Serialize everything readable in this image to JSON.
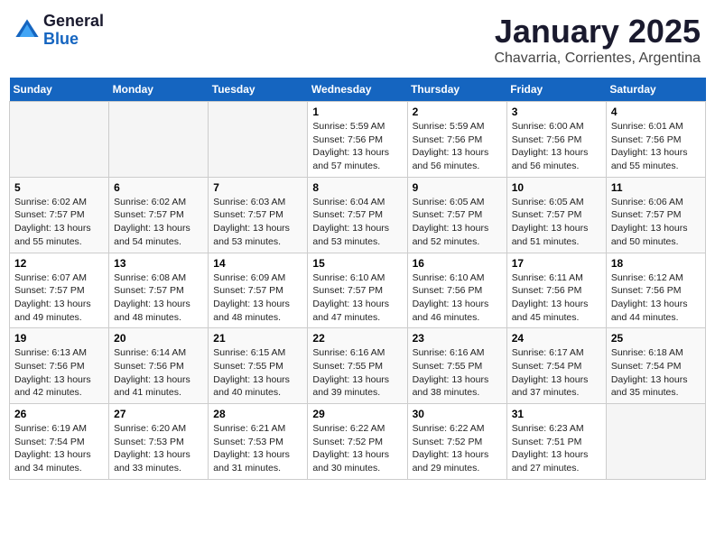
{
  "logo": {
    "general": "General",
    "blue": "Blue"
  },
  "title": "January 2025",
  "subtitle": "Chavarria, Corrientes, Argentina",
  "weekdays": [
    "Sunday",
    "Monday",
    "Tuesday",
    "Wednesday",
    "Thursday",
    "Friday",
    "Saturday"
  ],
  "weeks": [
    [
      {
        "day": "",
        "sunrise": "",
        "sunset": "",
        "daylight": ""
      },
      {
        "day": "",
        "sunrise": "",
        "sunset": "",
        "daylight": ""
      },
      {
        "day": "",
        "sunrise": "",
        "sunset": "",
        "daylight": ""
      },
      {
        "day": "1",
        "sunrise": "Sunrise: 5:59 AM",
        "sunset": "Sunset: 7:56 PM",
        "daylight": "Daylight: 13 hours and 57 minutes."
      },
      {
        "day": "2",
        "sunrise": "Sunrise: 5:59 AM",
        "sunset": "Sunset: 7:56 PM",
        "daylight": "Daylight: 13 hours and 56 minutes."
      },
      {
        "day": "3",
        "sunrise": "Sunrise: 6:00 AM",
        "sunset": "Sunset: 7:56 PM",
        "daylight": "Daylight: 13 hours and 56 minutes."
      },
      {
        "day": "4",
        "sunrise": "Sunrise: 6:01 AM",
        "sunset": "Sunset: 7:56 PM",
        "daylight": "Daylight: 13 hours and 55 minutes."
      }
    ],
    [
      {
        "day": "5",
        "sunrise": "Sunrise: 6:02 AM",
        "sunset": "Sunset: 7:57 PM",
        "daylight": "Daylight: 13 hours and 55 minutes."
      },
      {
        "day": "6",
        "sunrise": "Sunrise: 6:02 AM",
        "sunset": "Sunset: 7:57 PM",
        "daylight": "Daylight: 13 hours and 54 minutes."
      },
      {
        "day": "7",
        "sunrise": "Sunrise: 6:03 AM",
        "sunset": "Sunset: 7:57 PM",
        "daylight": "Daylight: 13 hours and 53 minutes."
      },
      {
        "day": "8",
        "sunrise": "Sunrise: 6:04 AM",
        "sunset": "Sunset: 7:57 PM",
        "daylight": "Daylight: 13 hours and 53 minutes."
      },
      {
        "day": "9",
        "sunrise": "Sunrise: 6:05 AM",
        "sunset": "Sunset: 7:57 PM",
        "daylight": "Daylight: 13 hours and 52 minutes."
      },
      {
        "day": "10",
        "sunrise": "Sunrise: 6:05 AM",
        "sunset": "Sunset: 7:57 PM",
        "daylight": "Daylight: 13 hours and 51 minutes."
      },
      {
        "day": "11",
        "sunrise": "Sunrise: 6:06 AM",
        "sunset": "Sunset: 7:57 PM",
        "daylight": "Daylight: 13 hours and 50 minutes."
      }
    ],
    [
      {
        "day": "12",
        "sunrise": "Sunrise: 6:07 AM",
        "sunset": "Sunset: 7:57 PM",
        "daylight": "Daylight: 13 hours and 49 minutes."
      },
      {
        "day": "13",
        "sunrise": "Sunrise: 6:08 AM",
        "sunset": "Sunset: 7:57 PM",
        "daylight": "Daylight: 13 hours and 48 minutes."
      },
      {
        "day": "14",
        "sunrise": "Sunrise: 6:09 AM",
        "sunset": "Sunset: 7:57 PM",
        "daylight": "Daylight: 13 hours and 48 minutes."
      },
      {
        "day": "15",
        "sunrise": "Sunrise: 6:10 AM",
        "sunset": "Sunset: 7:57 PM",
        "daylight": "Daylight: 13 hours and 47 minutes."
      },
      {
        "day": "16",
        "sunrise": "Sunrise: 6:10 AM",
        "sunset": "Sunset: 7:56 PM",
        "daylight": "Daylight: 13 hours and 46 minutes."
      },
      {
        "day": "17",
        "sunrise": "Sunrise: 6:11 AM",
        "sunset": "Sunset: 7:56 PM",
        "daylight": "Daylight: 13 hours and 45 minutes."
      },
      {
        "day": "18",
        "sunrise": "Sunrise: 6:12 AM",
        "sunset": "Sunset: 7:56 PM",
        "daylight": "Daylight: 13 hours and 44 minutes."
      }
    ],
    [
      {
        "day": "19",
        "sunrise": "Sunrise: 6:13 AM",
        "sunset": "Sunset: 7:56 PM",
        "daylight": "Daylight: 13 hours and 42 minutes."
      },
      {
        "day": "20",
        "sunrise": "Sunrise: 6:14 AM",
        "sunset": "Sunset: 7:56 PM",
        "daylight": "Daylight: 13 hours and 41 minutes."
      },
      {
        "day": "21",
        "sunrise": "Sunrise: 6:15 AM",
        "sunset": "Sunset: 7:55 PM",
        "daylight": "Daylight: 13 hours and 40 minutes."
      },
      {
        "day": "22",
        "sunrise": "Sunrise: 6:16 AM",
        "sunset": "Sunset: 7:55 PM",
        "daylight": "Daylight: 13 hours and 39 minutes."
      },
      {
        "day": "23",
        "sunrise": "Sunrise: 6:16 AM",
        "sunset": "Sunset: 7:55 PM",
        "daylight": "Daylight: 13 hours and 38 minutes."
      },
      {
        "day": "24",
        "sunrise": "Sunrise: 6:17 AM",
        "sunset": "Sunset: 7:54 PM",
        "daylight": "Daylight: 13 hours and 37 minutes."
      },
      {
        "day": "25",
        "sunrise": "Sunrise: 6:18 AM",
        "sunset": "Sunset: 7:54 PM",
        "daylight": "Daylight: 13 hours and 35 minutes."
      }
    ],
    [
      {
        "day": "26",
        "sunrise": "Sunrise: 6:19 AM",
        "sunset": "Sunset: 7:54 PM",
        "daylight": "Daylight: 13 hours and 34 minutes."
      },
      {
        "day": "27",
        "sunrise": "Sunrise: 6:20 AM",
        "sunset": "Sunset: 7:53 PM",
        "daylight": "Daylight: 13 hours and 33 minutes."
      },
      {
        "day": "28",
        "sunrise": "Sunrise: 6:21 AM",
        "sunset": "Sunset: 7:53 PM",
        "daylight": "Daylight: 13 hours and 31 minutes."
      },
      {
        "day": "29",
        "sunrise": "Sunrise: 6:22 AM",
        "sunset": "Sunset: 7:52 PM",
        "daylight": "Daylight: 13 hours and 30 minutes."
      },
      {
        "day": "30",
        "sunrise": "Sunrise: 6:22 AM",
        "sunset": "Sunset: 7:52 PM",
        "daylight": "Daylight: 13 hours and 29 minutes."
      },
      {
        "day": "31",
        "sunrise": "Sunrise: 6:23 AM",
        "sunset": "Sunset: 7:51 PM",
        "daylight": "Daylight: 13 hours and 27 minutes."
      },
      {
        "day": "",
        "sunrise": "",
        "sunset": "",
        "daylight": ""
      }
    ]
  ]
}
